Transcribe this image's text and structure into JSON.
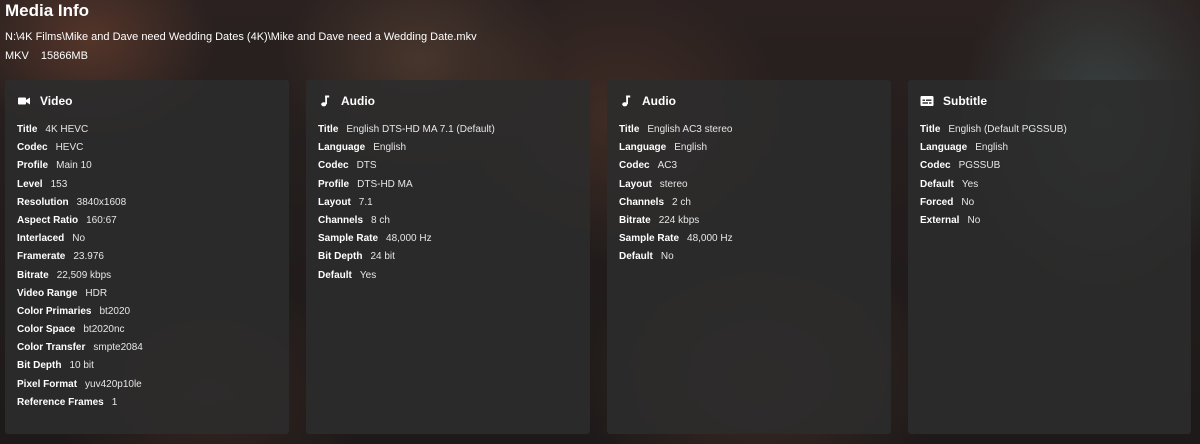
{
  "page": {
    "title": "Media Info",
    "path": "N:\\4K Films\\Mike and Dave need Wedding Dates (4K)\\Mike and Dave need a Wedding Date.mkv",
    "container": "MKV",
    "size": "15866MB"
  },
  "streams": [
    {
      "title": "Video",
      "icon": "video-camera-icon",
      "rows": [
        {
          "label": "Title",
          "value": "4K HEVC"
        },
        {
          "label": "Codec",
          "value": "HEVC"
        },
        {
          "label": "Profile",
          "value": "Main 10"
        },
        {
          "label": "Level",
          "value": "153"
        },
        {
          "label": "Resolution",
          "value": "3840x1608"
        },
        {
          "label": "Aspect Ratio",
          "value": "160:67"
        },
        {
          "label": "Interlaced",
          "value": "No"
        },
        {
          "label": "Framerate",
          "value": "23.976"
        },
        {
          "label": "Bitrate",
          "value": "22,509 kbps"
        },
        {
          "label": "Video Range",
          "value": "HDR"
        },
        {
          "label": "Color Primaries",
          "value": "bt2020"
        },
        {
          "label": "Color Space",
          "value": "bt2020nc"
        },
        {
          "label": "Color Transfer",
          "value": "smpte2084"
        },
        {
          "label": "Bit Depth",
          "value": "10 bit"
        },
        {
          "label": "Pixel Format",
          "value": "yuv420p10le"
        },
        {
          "label": "Reference Frames",
          "value": "1"
        }
      ]
    },
    {
      "title": "Audio",
      "icon": "music-note-icon",
      "rows": [
        {
          "label": "Title",
          "value": "English DTS-HD MA 7.1 (Default)"
        },
        {
          "label": "Language",
          "value": "English"
        },
        {
          "label": "Codec",
          "value": "DTS"
        },
        {
          "label": "Profile",
          "value": "DTS-HD MA"
        },
        {
          "label": "Layout",
          "value": "7.1"
        },
        {
          "label": "Channels",
          "value": "8 ch"
        },
        {
          "label": "Sample Rate",
          "value": "48,000 Hz"
        },
        {
          "label": "Bit Depth",
          "value": "24 bit"
        },
        {
          "label": "Default",
          "value": "Yes"
        }
      ]
    },
    {
      "title": "Audio",
      "icon": "music-note-icon",
      "rows": [
        {
          "label": "Title",
          "value": "English AC3 stereo"
        },
        {
          "label": "Language",
          "value": "English"
        },
        {
          "label": "Codec",
          "value": "AC3"
        },
        {
          "label": "Layout",
          "value": "stereo"
        },
        {
          "label": "Channels",
          "value": "2 ch"
        },
        {
          "label": "Bitrate",
          "value": "224 kbps"
        },
        {
          "label": "Sample Rate",
          "value": "48,000 Hz"
        },
        {
          "label": "Default",
          "value": "No"
        }
      ]
    },
    {
      "title": "Subtitle",
      "icon": "subtitles-icon",
      "rows": [
        {
          "label": "Title",
          "value": "English (Default PGSSUB)"
        },
        {
          "label": "Language",
          "value": "English"
        },
        {
          "label": "Codec",
          "value": "PGSSUB"
        },
        {
          "label": "Default",
          "value": "Yes"
        },
        {
          "label": "Forced",
          "value": "No"
        },
        {
          "label": "External",
          "value": "No"
        }
      ]
    }
  ]
}
